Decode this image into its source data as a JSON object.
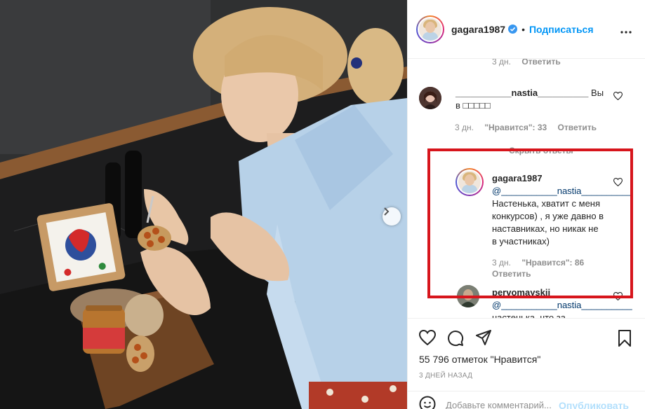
{
  "post": {
    "username": "gagara1987",
    "follow_label": "Подписаться",
    "separator": "•"
  },
  "comments": {
    "first_meta": {
      "time": "3 дн.",
      "reply": "Ответить"
    },
    "c1": {
      "username": "___________nastia__________",
      "text": "Вы в □□□□□",
      "meta": {
        "time": "3 дн.",
        "likes": "\"Нравится\": 33",
        "reply": "Ответить"
      }
    },
    "hide_replies": "Скрыть ответы",
    "reply1": {
      "username": "gagara1987",
      "mention": "@___________nastia__________",
      "text": "Настенька, хватит с меня конкурсов) , я уже давно в наставниках, но никак не в участниках)",
      "meta": {
        "time": "3 дн.",
        "likes": "\"Нравится\": 86",
        "reply": "Ответить"
      }
    },
    "reply2": {
      "username": "pervomayskii",
      "mention": "@___________nastia__________",
      "text": "настенька, что за"
    }
  },
  "likes_text": "55 796 отметок \"Нравится\"",
  "date_text": "3 дней назад",
  "add_comment": {
    "placeholder": "Добавьте комментарий...",
    "publish_label": "Опубликовать"
  },
  "colors": {
    "accent": "#0095f6",
    "highlight": "#d7151c",
    "publish_disabled": "#b2dffc"
  },
  "icons": [
    "verified-badge-icon",
    "more-options-icon",
    "heart-icon",
    "comment-icon",
    "share-icon",
    "bookmark-icon",
    "emoji-icon",
    "chevron-right-icon"
  ]
}
